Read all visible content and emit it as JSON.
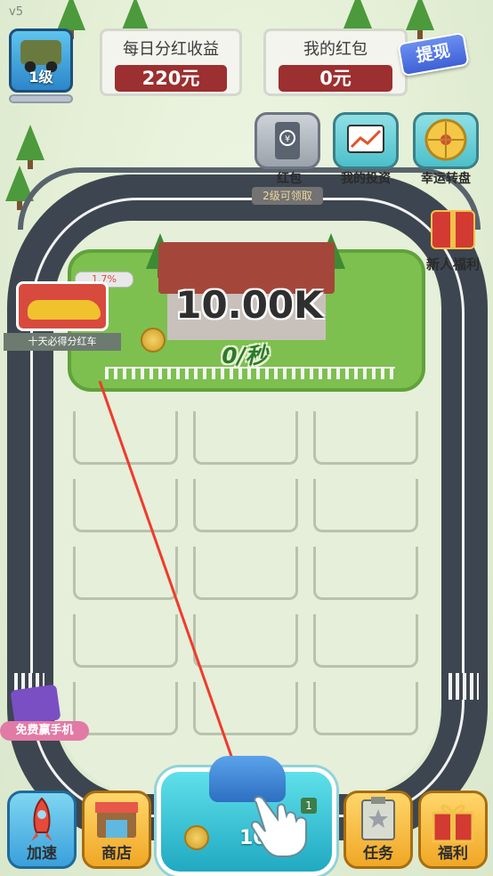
{
  "version": "v5",
  "player": {
    "level_label": "1级",
    "avatar_icon": "jeep-icon"
  },
  "daily_dividend": {
    "label": "每日分红收益",
    "value": "220元"
  },
  "red_packet_balance": {
    "label": "我的红包",
    "value": "0元",
    "withdraw_label": "提现"
  },
  "side_menu": {
    "red_packet": {
      "label": "红包",
      "hint": "2级可领取",
      "icon": "wallet-icon"
    },
    "investment": {
      "label": "我的投资",
      "icon": "chart-icon"
    },
    "lucky_wheel": {
      "label": "幸运转盘",
      "icon": "wheel-icon"
    },
    "newbie_gift": {
      "label": "新人福利",
      "icon": "gift-icon"
    }
  },
  "house": {
    "value": "10.00K",
    "rate": "0/秒"
  },
  "promo": {
    "percent": "1.7%",
    "caption": "十天必得分红车"
  },
  "free_phone": {
    "label": "免费赢手机"
  },
  "bottom_bar": {
    "speed": {
      "label": "加速",
      "icon": "rocket-icon"
    },
    "shop": {
      "label": "商店",
      "icon": "shop-icon"
    },
    "buy": {
      "price": "100",
      "level": "1",
      "icon": "blue-car-icon"
    },
    "tasks": {
      "label": "任务",
      "icon": "clipboard-icon"
    },
    "welfare": {
      "label": "福利",
      "icon": "gift-icon"
    }
  },
  "colors": {
    "accent_red": "#9c2f2f",
    "teal": "#4cc0c9",
    "track": "#3d4650",
    "grass": "#7dc04f"
  }
}
